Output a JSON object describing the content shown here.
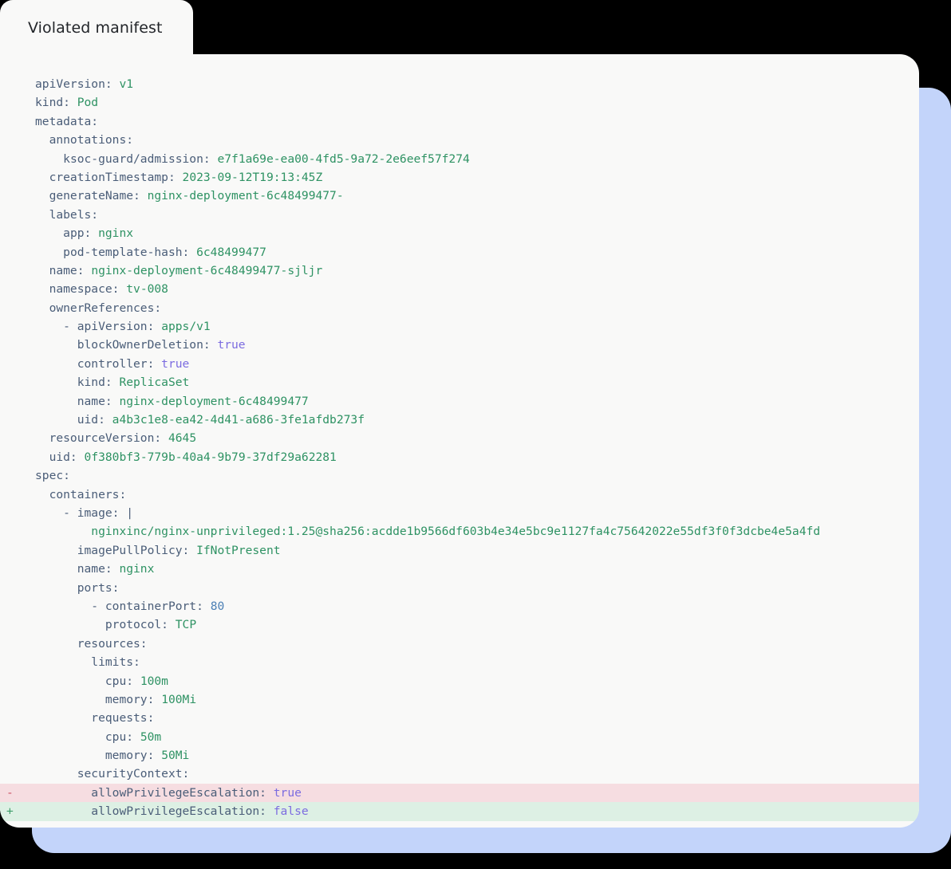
{
  "tab": {
    "label": "Violated manifest"
  },
  "colors": {
    "card_bg": "#f9f9f8",
    "backdrop_blue": "#c3d4fa",
    "key": "#4a5d78",
    "string": "#2e9263",
    "boolean": "#7c6ce0",
    "number": "#4a7fb5",
    "diff_removed_bg": "#f6dde1",
    "diff_added_bg": "#ddf0e4",
    "diff_minus_marker": "#cc5566",
    "diff_plus_marker": "#3f9e6a",
    "page_bg": "#000000"
  },
  "manifest": {
    "language": "yaml",
    "lines": [
      {
        "indent": 0,
        "diff": "none",
        "tokens": [
          {
            "t": "apiVersion:",
            "c": "k"
          },
          {
            "t": " ",
            "c": "k"
          },
          {
            "t": "v1",
            "c": "s"
          }
        ]
      },
      {
        "indent": 0,
        "diff": "none",
        "tokens": [
          {
            "t": "kind:",
            "c": "k"
          },
          {
            "t": " ",
            "c": "k"
          },
          {
            "t": "Pod",
            "c": "s"
          }
        ]
      },
      {
        "indent": 0,
        "diff": "none",
        "tokens": [
          {
            "t": "metadata:",
            "c": "k"
          }
        ]
      },
      {
        "indent": 1,
        "diff": "none",
        "tokens": [
          {
            "t": "annotations:",
            "c": "k"
          }
        ]
      },
      {
        "indent": 2,
        "diff": "none",
        "tokens": [
          {
            "t": "ksoc-guard/admission:",
            "c": "k"
          },
          {
            "t": " ",
            "c": "k"
          },
          {
            "t": "e7f1a69e-ea00-4fd5-9a72-2e6eef57f274",
            "c": "s"
          }
        ]
      },
      {
        "indent": 1,
        "diff": "none",
        "tokens": [
          {
            "t": "creationTimestamp:",
            "c": "k"
          },
          {
            "t": " ",
            "c": "k"
          },
          {
            "t": "2023-09-12T19:13:45Z",
            "c": "s"
          }
        ]
      },
      {
        "indent": 1,
        "diff": "none",
        "tokens": [
          {
            "t": "generateName:",
            "c": "k"
          },
          {
            "t": " ",
            "c": "k"
          },
          {
            "t": "nginx-deployment-6c48499477-",
            "c": "s"
          }
        ]
      },
      {
        "indent": 1,
        "diff": "none",
        "tokens": [
          {
            "t": "labels:",
            "c": "k"
          }
        ]
      },
      {
        "indent": 2,
        "diff": "none",
        "tokens": [
          {
            "t": "app:",
            "c": "k"
          },
          {
            "t": " ",
            "c": "k"
          },
          {
            "t": "nginx",
            "c": "s"
          }
        ]
      },
      {
        "indent": 2,
        "diff": "none",
        "tokens": [
          {
            "t": "pod-template-hash:",
            "c": "k"
          },
          {
            "t": " ",
            "c": "k"
          },
          {
            "t": "6c48499477",
            "c": "s"
          }
        ]
      },
      {
        "indent": 1,
        "diff": "none",
        "tokens": [
          {
            "t": "name:",
            "c": "k"
          },
          {
            "t": " ",
            "c": "k"
          },
          {
            "t": "nginx-deployment-6c48499477-sjljr",
            "c": "s"
          }
        ]
      },
      {
        "indent": 1,
        "diff": "none",
        "tokens": [
          {
            "t": "namespace:",
            "c": "k"
          },
          {
            "t": " ",
            "c": "k"
          },
          {
            "t": "tv-008",
            "c": "s"
          }
        ]
      },
      {
        "indent": 1,
        "diff": "none",
        "tokens": [
          {
            "t": "ownerReferences:",
            "c": "k"
          }
        ]
      },
      {
        "indent": 2,
        "diff": "none",
        "tokens": [
          {
            "t": "- ",
            "c": "d"
          },
          {
            "t": "apiVersion:",
            "c": "k"
          },
          {
            "t": " ",
            "c": "k"
          },
          {
            "t": "apps/v1",
            "c": "s"
          }
        ]
      },
      {
        "indent": 3,
        "diff": "none",
        "tokens": [
          {
            "t": "blockOwnerDeletion:",
            "c": "k"
          },
          {
            "t": " ",
            "c": "k"
          },
          {
            "t": "true",
            "c": "b"
          }
        ]
      },
      {
        "indent": 3,
        "diff": "none",
        "tokens": [
          {
            "t": "controller:",
            "c": "k"
          },
          {
            "t": " ",
            "c": "k"
          },
          {
            "t": "true",
            "c": "b"
          }
        ]
      },
      {
        "indent": 3,
        "diff": "none",
        "tokens": [
          {
            "t": "kind:",
            "c": "k"
          },
          {
            "t": " ",
            "c": "k"
          },
          {
            "t": "ReplicaSet",
            "c": "s"
          }
        ]
      },
      {
        "indent": 3,
        "diff": "none",
        "tokens": [
          {
            "t": "name:",
            "c": "k"
          },
          {
            "t": " ",
            "c": "k"
          },
          {
            "t": "nginx-deployment-6c48499477",
            "c": "s"
          }
        ]
      },
      {
        "indent": 3,
        "diff": "none",
        "tokens": [
          {
            "t": "uid:",
            "c": "k"
          },
          {
            "t": " ",
            "c": "k"
          },
          {
            "t": "a4b3c1e8-ea42-4d41-a686-3fe1afdb273f",
            "c": "s"
          }
        ]
      },
      {
        "indent": 1,
        "diff": "none",
        "tokens": [
          {
            "t": "resourceVersion:",
            "c": "k"
          },
          {
            "t": " ",
            "c": "k"
          },
          {
            "t": "4645",
            "c": "s"
          }
        ]
      },
      {
        "indent": 1,
        "diff": "none",
        "tokens": [
          {
            "t": "uid:",
            "c": "k"
          },
          {
            "t": " ",
            "c": "k"
          },
          {
            "t": "0f380bf3-779b-40a4-9b79-37df29a62281",
            "c": "s"
          }
        ]
      },
      {
        "indent": 0,
        "diff": "none",
        "tokens": [
          {
            "t": "spec:",
            "c": "k"
          }
        ]
      },
      {
        "indent": 1,
        "diff": "none",
        "tokens": [
          {
            "t": "containers:",
            "c": "k"
          }
        ]
      },
      {
        "indent": 2,
        "diff": "none",
        "tokens": [
          {
            "t": "- ",
            "c": "d"
          },
          {
            "t": "image:",
            "c": "k"
          },
          {
            "t": " ",
            "c": "k"
          },
          {
            "t": "|",
            "c": "d"
          }
        ]
      },
      {
        "indent": 4,
        "diff": "none",
        "tokens": [
          {
            "t": "nginxinc/nginx-unprivileged:1.25@sha256:acdde1b9566df603b4e34e5bc9e1127fa4c75642022e55df3f0f3dcbe4e5a4fd",
            "c": "s"
          }
        ]
      },
      {
        "indent": 3,
        "diff": "none",
        "tokens": [
          {
            "t": "imagePullPolicy:",
            "c": "k"
          },
          {
            "t": " ",
            "c": "k"
          },
          {
            "t": "IfNotPresent",
            "c": "s"
          }
        ]
      },
      {
        "indent": 3,
        "diff": "none",
        "tokens": [
          {
            "t": "name:",
            "c": "k"
          },
          {
            "t": " ",
            "c": "k"
          },
          {
            "t": "nginx",
            "c": "s"
          }
        ]
      },
      {
        "indent": 3,
        "diff": "none",
        "tokens": [
          {
            "t": "ports:",
            "c": "k"
          }
        ]
      },
      {
        "indent": 4,
        "diff": "none",
        "tokens": [
          {
            "t": "- ",
            "c": "d"
          },
          {
            "t": "containerPort:",
            "c": "k"
          },
          {
            "t": " ",
            "c": "k"
          },
          {
            "t": "80",
            "c": "n"
          }
        ]
      },
      {
        "indent": 5,
        "diff": "none",
        "tokens": [
          {
            "t": "protocol:",
            "c": "k"
          },
          {
            "t": " ",
            "c": "k"
          },
          {
            "t": "TCP",
            "c": "s"
          }
        ]
      },
      {
        "indent": 3,
        "diff": "none",
        "tokens": [
          {
            "t": "resources:",
            "c": "k"
          }
        ]
      },
      {
        "indent": 4,
        "diff": "none",
        "tokens": [
          {
            "t": "limits:",
            "c": "k"
          }
        ]
      },
      {
        "indent": 5,
        "diff": "none",
        "tokens": [
          {
            "t": "cpu:",
            "c": "k"
          },
          {
            "t": " ",
            "c": "k"
          },
          {
            "t": "100m",
            "c": "s"
          }
        ]
      },
      {
        "indent": 5,
        "diff": "none",
        "tokens": [
          {
            "t": "memory:",
            "c": "k"
          },
          {
            "t": " ",
            "c": "k"
          },
          {
            "t": "100Mi",
            "c": "s"
          }
        ]
      },
      {
        "indent": 4,
        "diff": "none",
        "tokens": [
          {
            "t": "requests:",
            "c": "k"
          }
        ]
      },
      {
        "indent": 5,
        "diff": "none",
        "tokens": [
          {
            "t": "cpu:",
            "c": "k"
          },
          {
            "t": " ",
            "c": "k"
          },
          {
            "t": "50m",
            "c": "s"
          }
        ]
      },
      {
        "indent": 5,
        "diff": "none",
        "tokens": [
          {
            "t": "memory:",
            "c": "k"
          },
          {
            "t": " ",
            "c": "k"
          },
          {
            "t": "50Mi",
            "c": "s"
          }
        ]
      },
      {
        "indent": 3,
        "diff": "none",
        "tokens": [
          {
            "t": "securityContext:",
            "c": "k"
          }
        ]
      },
      {
        "indent": 4,
        "diff": "del",
        "marker": "-",
        "tokens": [
          {
            "t": "allowPrivilegeEscalation:",
            "c": "k"
          },
          {
            "t": " ",
            "c": "k"
          },
          {
            "t": "true",
            "c": "b"
          }
        ]
      },
      {
        "indent": 4,
        "diff": "add",
        "marker": "+",
        "tokens": [
          {
            "t": "allowPrivilegeEscalation:",
            "c": "k"
          },
          {
            "t": " ",
            "c": "k"
          },
          {
            "t": "false",
            "c": "b"
          }
        ]
      }
    ]
  }
}
